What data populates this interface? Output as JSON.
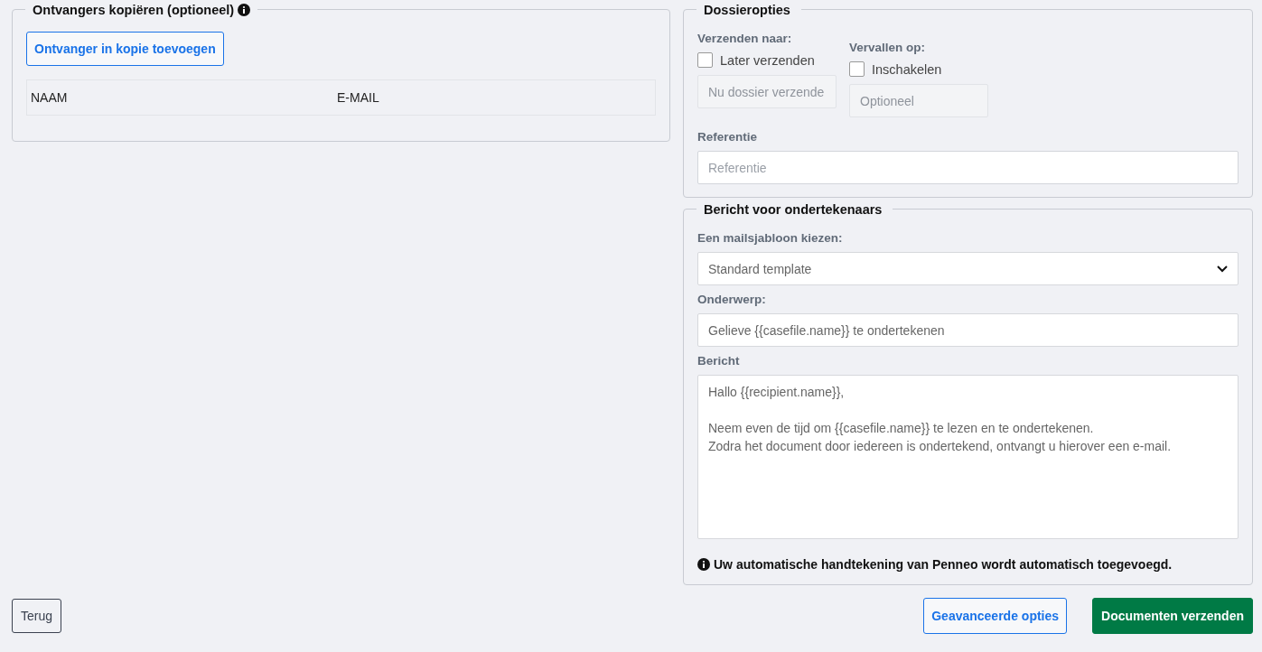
{
  "copy_recipients": {
    "title": "Ontvangers kopiëren (optioneel)",
    "add_button": "Ontvanger in kopie toevoegen",
    "table": {
      "columns": [
        "NAAM",
        "E-MAIL"
      ]
    }
  },
  "case_options": {
    "title": "Dossieropties",
    "send_at": {
      "label": "Verzenden naar:",
      "checkbox": {
        "label": "Later verzenden",
        "checked": false
      },
      "field": {
        "placeholder": "Nu dossier verzende",
        "disabled": true
      }
    },
    "expire": {
      "label": "Vervallen op:",
      "checkbox": {
        "label": "Inschakelen",
        "checked": false
      },
      "field": {
        "placeholder": "Optioneel",
        "disabled": true
      }
    },
    "reference": {
      "label": "Referentie",
      "field": {
        "placeholder": "Referentie",
        "disabled": false
      }
    }
  },
  "message": {
    "title": "Bericht voor ondertekenaars",
    "template": {
      "label": "Een mailsjabloon kiezen:",
      "value": "Standard template"
    },
    "subject": {
      "label": "Onderwerp:",
      "value": "Gelieve {{casefile.name}} te ondertekenen"
    },
    "body": {
      "label": "Bericht",
      "value": "Hallo {{recipient.name}},\n\nNeem even de tijd om {{casefile.name}} te lezen en te ondertekenen.\nZodra het document door iedereen is ondertekend, ontvangt u hierover een e-mail."
    },
    "note": "Uw automatische handtekening van Penneo wordt automatisch toegevoegd."
  },
  "footer": {
    "buttons": [
      {
        "label": "Terug",
        "kind": "secondary"
      },
      {
        "label": "Geavanceerde opties",
        "kind": "outline"
      },
      {
        "label": "Documenten verzenden",
        "kind": "primary"
      }
    ]
  }
}
